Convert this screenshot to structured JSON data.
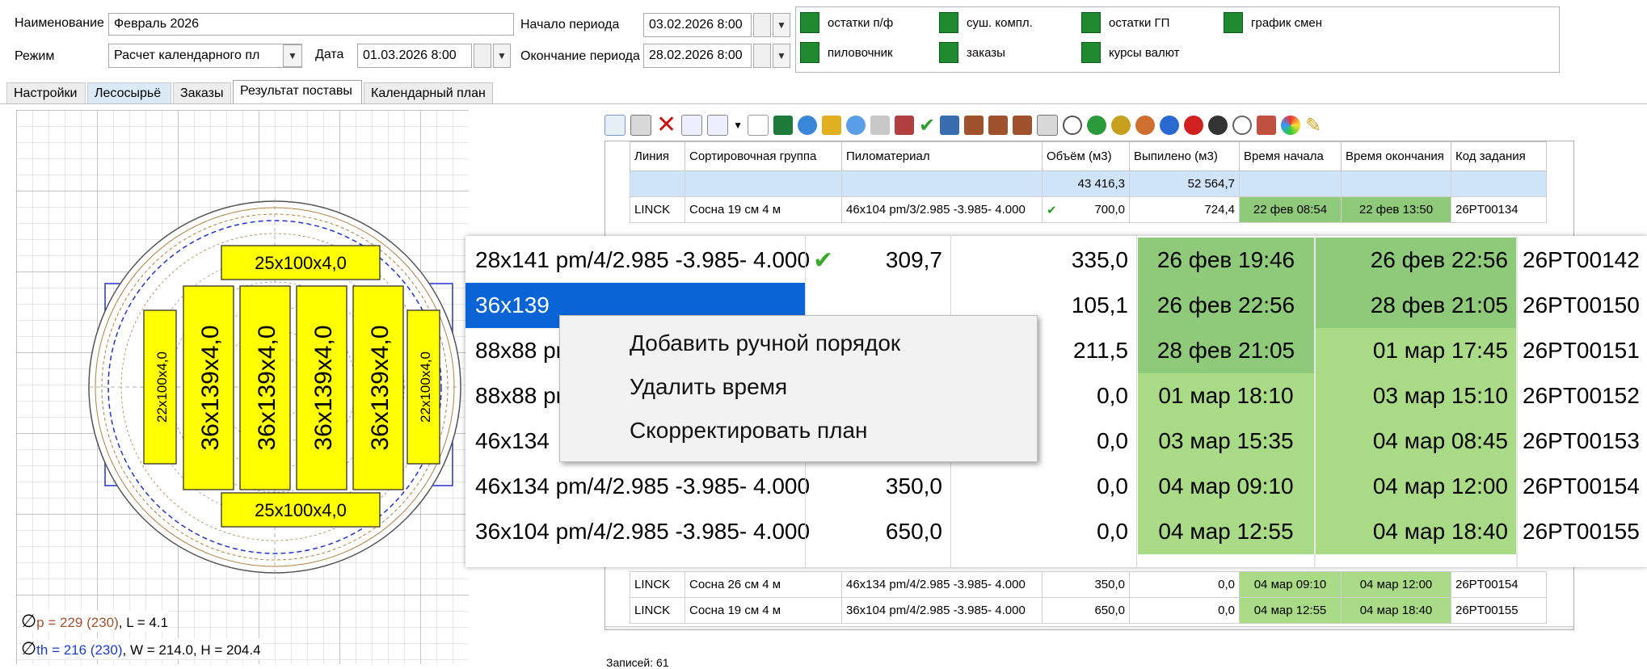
{
  "form": {
    "name_label": "Наименование",
    "name_value": "Февраль 2026",
    "mode_label": "Режим",
    "mode_value": "Расчет календарного пл",
    "date_label": "Дата",
    "date_value": "01.03.2026 8:00",
    "start_label": "Начало периода",
    "start_value": "03.02.2026 8:00",
    "end_label": "Окончание периода",
    "end_value": "28.02.2026 8:00"
  },
  "checks": [
    {
      "label": "остатки п/ф"
    },
    {
      "label": "суш. компл."
    },
    {
      "label": "остатки ГП"
    },
    {
      "label": "график смен"
    },
    {
      "label": "пиловочник"
    },
    {
      "label": "заказы"
    },
    {
      "label": "курсы валют"
    }
  ],
  "tabs": [
    "Настройки",
    "Лесосырьё",
    "Заказы",
    "Результат поставы",
    "Календарный план"
  ],
  "diagram": {
    "top_board": "25x100x4,0",
    "bottom_board": "25x100x4,0",
    "center_boards": [
      "36x139x4,0",
      "36x139x4,0",
      "36x139x4,0",
      "36x139x4,0"
    ],
    "left_board": "22x100x4,0",
    "right_board": "22x100x4,0",
    "info1": {
      "sym": "∅",
      "colored": "p = 229 (230)",
      "rest": ", L = 4.1"
    },
    "info2": {
      "sym": "∅",
      "colored": "th = 216 (230)",
      "rest": ", W = 214.0, H = 204.4"
    }
  },
  "columns": [
    "Линия",
    "Сортировочная группа",
    "Пиломатериал",
    "Объём (м3)",
    "Выпилено (м3)",
    "Время начала",
    "Время окончания",
    "Код задания"
  ],
  "totals": {
    "volume": "43 416,3",
    "cut": "52 564,7"
  },
  "partial_top_row": {
    "line": "LINCK",
    "group": "Сосна 19 см 4 м",
    "material": "...",
    "volume": "...",
    "cut": "...",
    "start": "...",
    "end": "...",
    "code": "..."
  },
  "rows": [
    {
      "line": "LINCK",
      "group": "Сосна 19 см 4 м",
      "material": "46x104 pm/3/2.985 -3.985- 4.000",
      "volume": "700,0",
      "cut": "724,4",
      "start": "22 фев 08:54",
      "end": "22 фев 13:50",
      "code": "26PT00134"
    }
  ],
  "bottom_rows": [
    {
      "line": "LINCK",
      "group": "Сосна 26 см 4 м",
      "material": "46x134 pm/4/2.985 -3.985- 4.000",
      "volume": "350,0",
      "cut": "0,0",
      "start": "04 мар 09:10",
      "end": "04 мар 12:00",
      "code": "26PT00154"
    },
    {
      "line": "LINCK",
      "group": "Сосна 19 см 4 м",
      "material": "36x104 pm/4/2.985 -3.985- 4.000",
      "volume": "650,0",
      "cut": "0,0",
      "start": "04 мар 12:55",
      "end": "04 мар 18:40",
      "code": "26PT00155"
    }
  ],
  "zoom_rows": [
    {
      "material": "28x141 pm/4/2.985 -3.985- 4.000",
      "volume": "309,7",
      "cut": "335,0",
      "start": "26 фев 19:46",
      "end": "26 фев 22:56",
      "code": "26PT00142",
      "check": true
    },
    {
      "material": "36x139",
      "volume": "",
      "cut": "105,1",
      "start": "26 фев 22:56",
      "end": "28 фев 21:05",
      "code": "26PT00150",
      "check": false
    },
    {
      "material": "88x88 pr",
      "volume": "",
      "cut": "211,5",
      "start": "28 фев 21:05",
      "end": "01 мар 17:45",
      "code": "26PT00151",
      "check": false
    },
    {
      "material": "88x88 pr",
      "volume": "",
      "cut": "0,0",
      "start": "01 мар 18:10",
      "end": "03 мар 15:10",
      "code": "26PT00152",
      "check": false
    },
    {
      "material": "46x134",
      "volume": "",
      "cut": "0,0",
      "start": "03 мар 15:35",
      "end": "04 мар 08:45",
      "code": "26PT00153",
      "check": false
    },
    {
      "material": "46x134 pm/4/2.985 -3.985- 4.000",
      "volume": "350,0",
      "cut": "0,0",
      "start": "04 мар 09:10",
      "end": "04 мар 12:00",
      "code": "26PT00154",
      "check": false
    },
    {
      "material": "36x104 pm/4/2.985 -3.985- 4.000",
      "volume": "650,0",
      "cut": "0,0",
      "start": "04 мар 12:55",
      "end": "04 мар 18:40",
      "code": "26PT00155",
      "check": false
    }
  ],
  "menu": [
    "Добавить ручной порядок",
    "Удалить время",
    "Скорректировать план"
  ],
  "status": "Записей: 61",
  "colors": {
    "check_green": "#1f8a2f",
    "cell_mid": "#8fc97a",
    "cell_light": "#a9da86",
    "board": "#ffff00",
    "selection": "#0a64d6"
  }
}
